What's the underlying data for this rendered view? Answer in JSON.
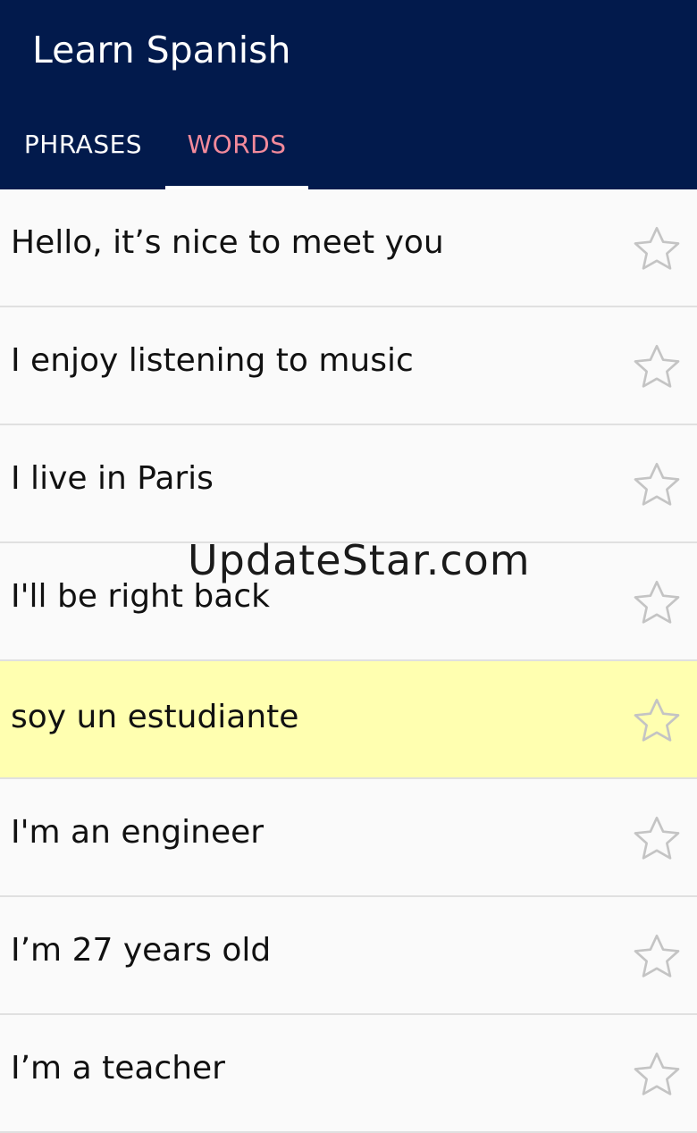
{
  "app": {
    "title": "Learn Spanish"
  },
  "tabs": [
    {
      "label": "PHRASES",
      "active": false
    },
    {
      "label": "WORDS",
      "active": true
    }
  ],
  "items": [
    {
      "text": "Hello, it’s nice to meet you",
      "highlighted": false
    },
    {
      "text": "I enjoy listening to music",
      "highlighted": false
    },
    {
      "text": "I live in Paris",
      "highlighted": false
    },
    {
      "text": "I'll be right back",
      "highlighted": false
    },
    {
      "text": "soy un estudiante",
      "highlighted": true
    },
    {
      "text": "I'm an engineer",
      "highlighted": false
    },
    {
      "text": "I’m 27 years old",
      "highlighted": false
    },
    {
      "text": "I’m a teacher",
      "highlighted": false
    }
  ],
  "watermark": "UpdateStar.com",
  "colors": {
    "app_bar": "#021a4c",
    "active_tab_text": "#f38a9b",
    "highlight_row": "#ffffb0",
    "star_outline": "#c4c4c4"
  },
  "icons": {
    "favorite": "star-outline-icon"
  }
}
